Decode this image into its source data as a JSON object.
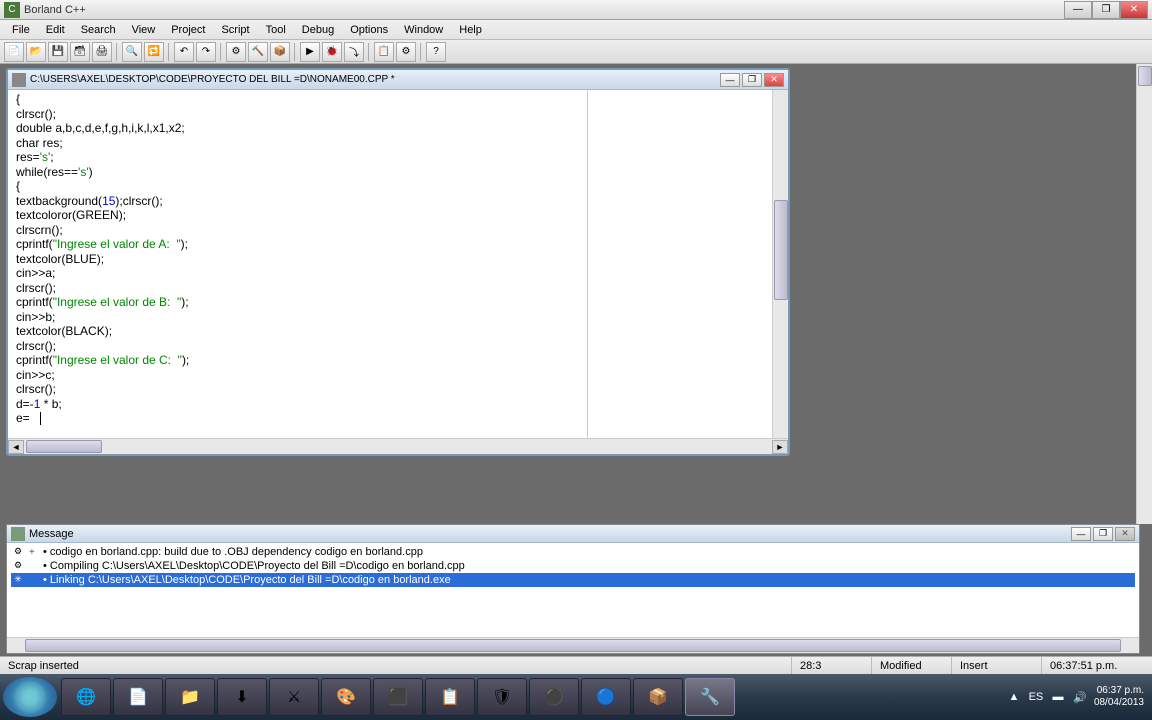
{
  "app": {
    "title": "Borland C++"
  },
  "menu": {
    "items": [
      "File",
      "Edit",
      "Search",
      "View",
      "Project",
      "Script",
      "Tool",
      "Debug",
      "Options",
      "Window",
      "Help"
    ]
  },
  "editor": {
    "title": "C:\\USERS\\AXEL\\DESKTOP\\CODE\\PROYECTO DEL BILL =D\\NONAME00.CPP *",
    "code_lines": [
      {
        "t": "{"
      },
      {
        "t": "clrscr();"
      },
      {
        "t": "double a,b,c,d,e,f,g,h,i,k,l,x1,x2;"
      },
      {
        "t": "char res;"
      },
      {
        "t": "res='s';",
        "str": [
          "'s'"
        ]
      },
      {
        "t": "while(res=='s')",
        "str": [
          "'s'"
        ]
      },
      {
        "t": "{"
      },
      {
        "t": "textbackground(15);clrscr();",
        "num": [
          "15"
        ]
      },
      {
        "t": "textcoloror(GREEN);"
      },
      {
        "t": "clrscrn();"
      },
      {
        "t": "cprintf(\"Ingrese el valor de A:  \");",
        "str": [
          "\"Ingrese el valor de A:  \""
        ]
      },
      {
        "t": "textcolor(BLUE);"
      },
      {
        "t": "cin>>a;"
      },
      {
        "t": "clrscr();"
      },
      {
        "t": "cprintf(\"Ingrese el valor de B:  \");",
        "str": [
          "\"Ingrese el valor de B:  \""
        ]
      },
      {
        "t": "cin>>b;"
      },
      {
        "t": "textcolor(BLACK);"
      },
      {
        "t": "clrscr();"
      },
      {
        "t": "cprintf(\"Ingrese el valor de C:  \");",
        "str": [
          "\"Ingrese el valor de C:  \""
        ]
      },
      {
        "t": "cin>>c;"
      },
      {
        "t": "clrscr();"
      },
      {
        "t": "d=-1 * b;",
        "num": [
          "1"
        ]
      },
      {
        "t": "e=",
        "cursor": true
      }
    ]
  },
  "message": {
    "title": "Message",
    "lines": [
      {
        "badge": "⚙",
        "text": "codigo en borland.cpp: build due to .OBJ dependency codigo en borland.cpp",
        "plus": "+"
      },
      {
        "badge": "⚙",
        "text": "Compiling C:\\Users\\AXEL\\Desktop\\CODE\\Proyecto del Bill =D\\codigo en borland.cpp",
        "plus": ""
      },
      {
        "badge": "✳",
        "text": "Linking C:\\Users\\AXEL\\Desktop\\CODE\\Proyecto del Bill =D\\codigo en borland.exe",
        "plus": "",
        "hl": true
      }
    ]
  },
  "status": {
    "left": "Scrap inserted",
    "pos": "28:3",
    "modified": "Modified",
    "insert": "Insert",
    "time1": "06:37:51 p.m."
  },
  "tray": {
    "lang": "ES",
    "time": "06:37 p.m.",
    "date": "08/04/2013"
  },
  "taskbar_icons": [
    "🌐",
    "📄",
    "📁",
    "⬇",
    "⚔",
    "🎨",
    "⬛",
    "📋",
    "🛡",
    "⚫",
    "🔵",
    "📦",
    "🔧"
  ]
}
